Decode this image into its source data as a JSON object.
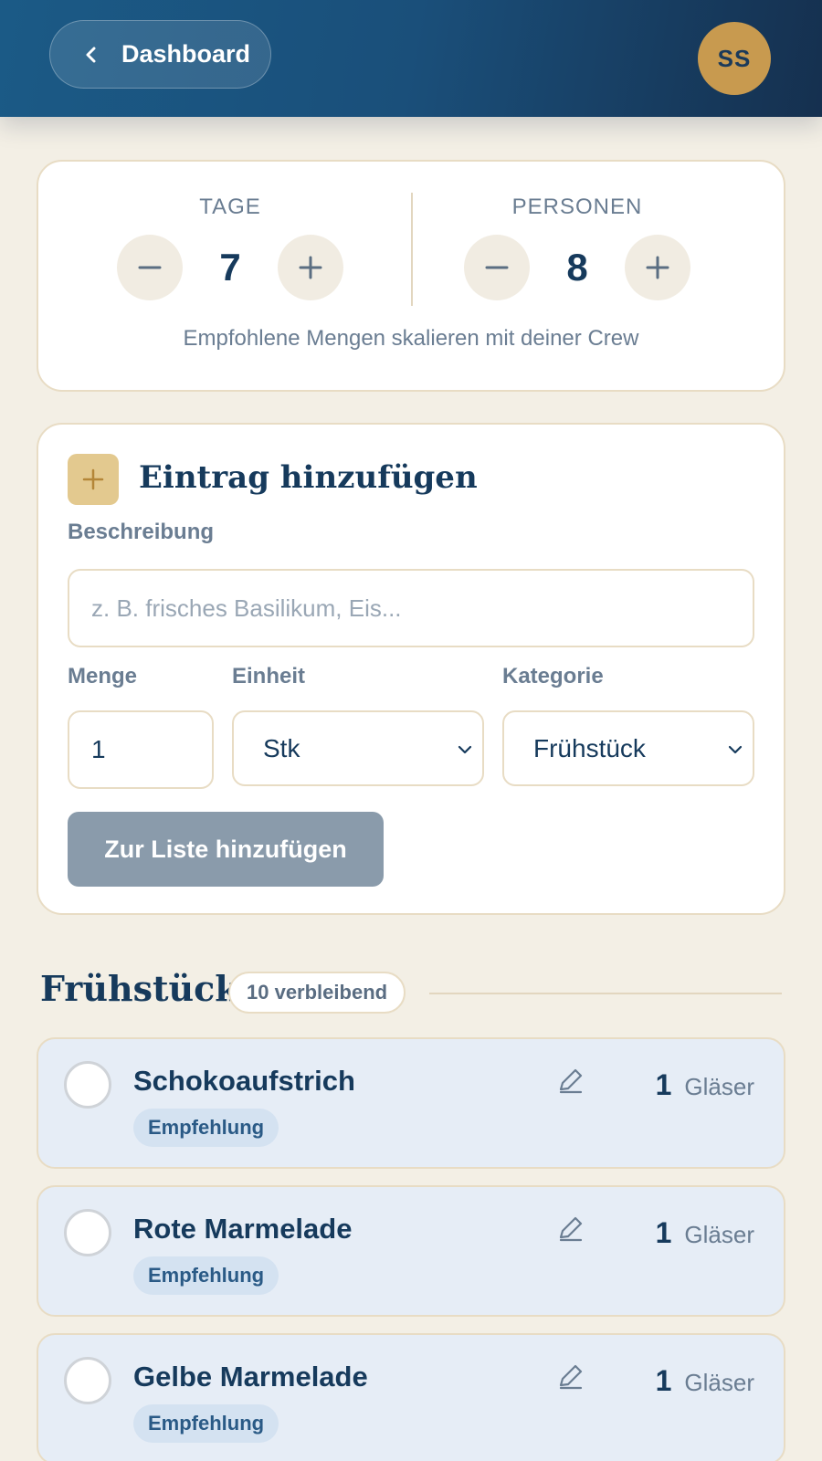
{
  "header": {
    "back_label": "Dashboard",
    "avatar_initials": "SS"
  },
  "counters": {
    "days": {
      "label": "TAGE",
      "value": "7"
    },
    "persons": {
      "label": "PERSONEN",
      "value": "8"
    },
    "hint": "Empfohlene Mengen skalieren mit deiner Crew"
  },
  "add_entry": {
    "title": "Eintrag hinzufügen",
    "description_label": "Beschreibung",
    "description_placeholder": "z. B. frisches Basilikum, Eis...",
    "quantity_label": "Menge",
    "quantity_value": "1",
    "unit_label": "Einheit",
    "unit_value": "Stk",
    "category_label": "Kategorie",
    "category_value": "Frühstück",
    "submit_label": "Zur Liste hinzufügen"
  },
  "section": {
    "title": "Frühstück",
    "remaining": "10 verbleibend",
    "items": [
      {
        "name": "Schokoaufstrich",
        "tag": "Empfehlung",
        "quantity": "1",
        "unit": "Gläser"
      },
      {
        "name": "Rote Marmelade",
        "tag": "Empfehlung",
        "quantity": "1",
        "unit": "Gläser"
      },
      {
        "name": "Gelbe Marmelade",
        "tag": "Empfehlung",
        "quantity": "1",
        "unit": "Gläser"
      }
    ]
  },
  "colors": {
    "header_start": "#1b5a86",
    "header_end": "#15304f",
    "accent_gold": "#c89a4f",
    "background": "#f3efe5",
    "item_background": "#e6edf6",
    "disabled_button": "#8a9bab"
  }
}
